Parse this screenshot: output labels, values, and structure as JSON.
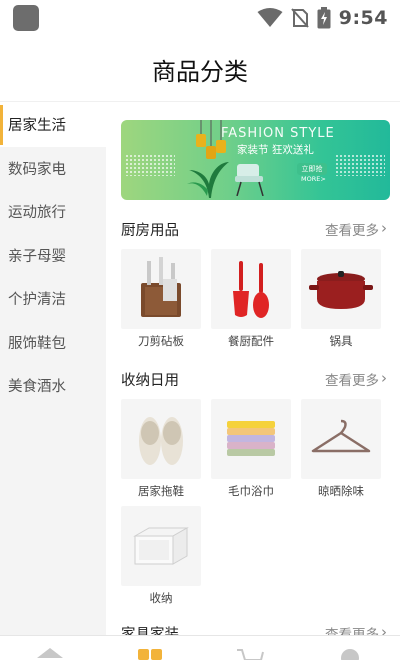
{
  "status_bar": {
    "time": "9:54"
  },
  "header": {
    "title": "商品分类"
  },
  "sidebar": {
    "items": [
      {
        "label": "居家生活",
        "active": true
      },
      {
        "label": "数码家电"
      },
      {
        "label": "运动旅行"
      },
      {
        "label": "亲子母婴"
      },
      {
        "label": "个护清洁"
      },
      {
        "label": "服饰鞋包"
      },
      {
        "label": "美食酒水"
      }
    ]
  },
  "banner": {
    "title": "FASHION STYLE",
    "subtitle": "家装节 狂欢送礼",
    "tag": "立即抢",
    "more": "MORE>"
  },
  "sections": [
    {
      "title": "厨房用品",
      "more": "查看更多",
      "products": [
        {
          "label": "刀剪砧板",
          "icon": "knife-set-icon"
        },
        {
          "label": "餐厨配件",
          "icon": "kitchen-utensils-icon"
        },
        {
          "label": "锅具",
          "icon": "pot-icon"
        }
      ]
    },
    {
      "title": "收纳日用",
      "more": "查看更多",
      "products": [
        {
          "label": "居家拖鞋",
          "icon": "slippers-icon"
        },
        {
          "label": "毛巾浴巾",
          "icon": "towels-icon"
        },
        {
          "label": "晾晒除味",
          "icon": "hanger-icon"
        },
        {
          "label": "收纳",
          "icon": "storage-box-icon"
        }
      ]
    },
    {
      "title": "家具家装",
      "more": "查看更多"
    }
  ],
  "tabbar": {
    "tabs": [
      {
        "icon": "home-icon"
      },
      {
        "icon": "category-icon",
        "active": true
      },
      {
        "icon": "cart-icon"
      },
      {
        "icon": "profile-icon"
      }
    ],
    "accent": "#f2b33a"
  }
}
